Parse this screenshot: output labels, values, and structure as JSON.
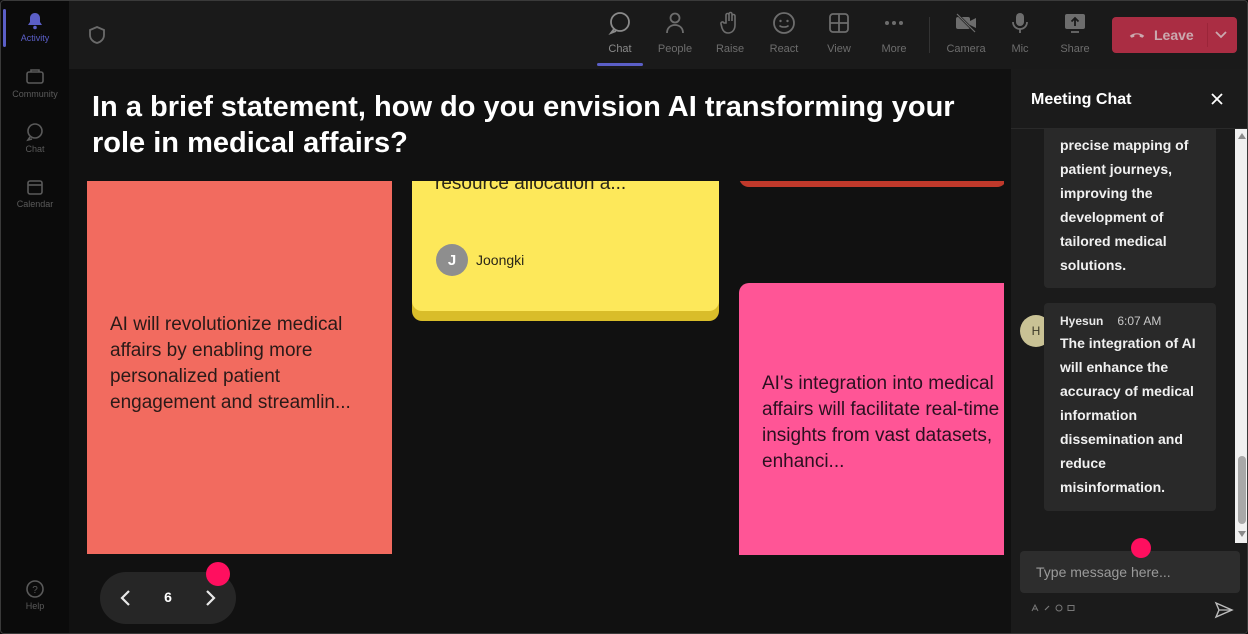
{
  "rail": {
    "items": [
      {
        "label": "Activity",
        "icon": "bell-icon"
      },
      {
        "label": "Community",
        "icon": "community-icon"
      },
      {
        "label": "Chat",
        "icon": "chat-icon"
      },
      {
        "label": "Calendar",
        "icon": "calendar-icon"
      },
      {
        "label": "Help",
        "icon": "help-icon"
      }
    ]
  },
  "toolbar": {
    "buttons": [
      {
        "label": "Chat",
        "icon": "chat-icon"
      },
      {
        "label": "People",
        "icon": "people-icon"
      },
      {
        "label": "Raise",
        "icon": "raise-hand-icon"
      },
      {
        "label": "React",
        "icon": "smiley-icon"
      },
      {
        "label": "View",
        "icon": "grid-icon"
      },
      {
        "label": "More",
        "icon": "more-icon"
      },
      {
        "label": "Camera",
        "icon": "camera-off-icon"
      },
      {
        "label": "Mic",
        "icon": "mic-icon"
      },
      {
        "label": "Share",
        "icon": "share-icon"
      }
    ],
    "leave_label": "Leave",
    "leave_color": "#c4314b",
    "accent_color": "#5b5fc7"
  },
  "stage": {
    "question": "In a brief statement, how do you envision AI transforming your role in medical affairs?",
    "cards": {
      "coral_text": "AI will revolutionize medical affairs by enabling more personalized patient engagement and streamlin...",
      "yellow_text": "resource allocation a...",
      "yellow_author_initial": "J",
      "yellow_author": "Joongki",
      "pink_text": "AI's integration into medical affairs will facilitate real-time insights from vast datasets, enhanci..."
    },
    "page_number": "6"
  },
  "chat": {
    "title": "Meeting Chat",
    "messages": [
      {
        "body": "precise mapping of patient journeys, improving the development of tailored medical solutions."
      },
      {
        "author": "Hyesun",
        "author_initial": "H",
        "time": "6:07 AM",
        "body": "The integration of AI will enhance the accuracy of medical information dissemination and reduce misinformation."
      }
    ],
    "input_placeholder": "Type message here..."
  }
}
